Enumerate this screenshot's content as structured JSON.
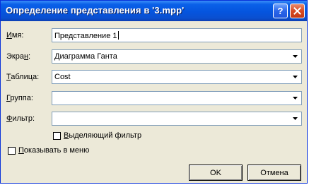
{
  "window": {
    "title": "Определение представления в '3.mpp'",
    "help_label": "?",
    "titlebar_color": "#0555de",
    "close_color": "#d84a22"
  },
  "form": {
    "name": {
      "label_pre": "",
      "label_key": "И",
      "label_post": "мя:",
      "value": "Представление 1"
    },
    "screen": {
      "label_pre": "Экра",
      "label_key": "н",
      "label_post": ":",
      "value": "Диаграмма Ганта"
    },
    "table": {
      "label_pre": "",
      "label_key": "Т",
      "label_post": "аблица:",
      "value": "Cost"
    },
    "group": {
      "label_pre": "",
      "label_key": "Г",
      "label_post": "руппа:",
      "value": ""
    },
    "filter": {
      "label_pre": "",
      "label_key": "Ф",
      "label_post": "ильтр:",
      "value": ""
    }
  },
  "checkboxes": {
    "highlight_filter": {
      "label_pre": "",
      "label_key": "В",
      "label_post": "ыделяющий фильтр",
      "checked": false
    },
    "show_in_menu": {
      "label_pre": "",
      "label_key": "П",
      "label_post": "оказывать в меню",
      "checked": false
    }
  },
  "buttons": {
    "ok": "OK",
    "cancel": "Отмена"
  },
  "icons": {
    "help": "help-icon",
    "close": "close-icon",
    "dropdown": "chevron-down-icon"
  }
}
